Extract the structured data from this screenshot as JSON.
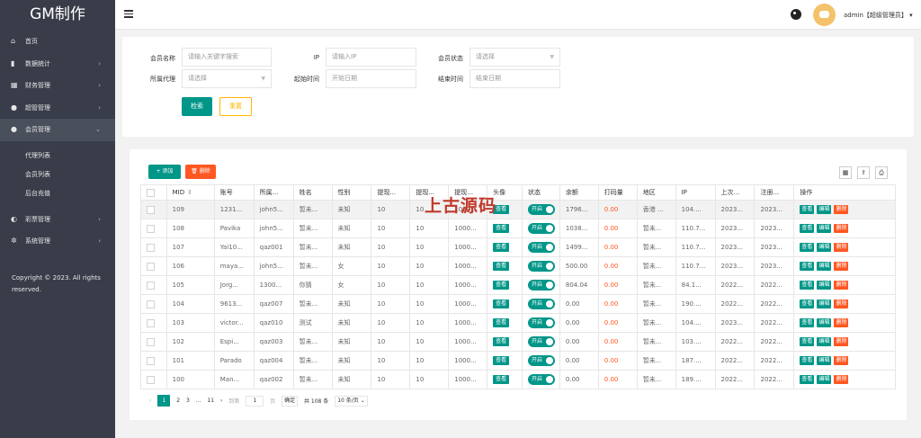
{
  "sidebar": {
    "logo": "GM制作",
    "items": [
      {
        "label": "首页",
        "icon": "home-icon",
        "glyph": "⌂",
        "arrow": ""
      },
      {
        "label": "数据统计",
        "icon": "bar-chart-icon",
        "glyph": "▮",
        "arrow": "›"
      },
      {
        "label": "财务管理",
        "icon": "bank-icon",
        "glyph": "▦",
        "arrow": "›"
      },
      {
        "label": "超管管理",
        "icon": "user-icon",
        "glyph": "●",
        "arrow": "›"
      },
      {
        "label": "会员管理",
        "icon": "users-icon",
        "glyph": "●",
        "arrow": "⌄"
      }
    ],
    "sub_items": [
      "代理列表",
      "会员列表",
      "后台充值"
    ],
    "bottom_items": [
      {
        "label": "彩票管理",
        "icon": "gamepad-icon",
        "glyph": "◐",
        "arrow": "›"
      },
      {
        "label": "系统管理",
        "icon": "gear-icon",
        "glyph": "✲",
        "arrow": "›"
      }
    ],
    "copyright": "Copyright © 2023. All rights reserved."
  },
  "header": {
    "user": "admin【超级管理员】",
    "user_caret": "▾"
  },
  "search": {
    "member_name_label": "会员名称",
    "member_name_placeholder": "请输入关键字搜索",
    "ip_label": "IP",
    "ip_placeholder": "请输入IP",
    "status_label": "会员状态",
    "status_placeholder": "请选择",
    "agent_label": "所属代理",
    "agent_placeholder": "请选择",
    "start_label": "起始时间",
    "start_placeholder": "开始日期",
    "end_label": "结束时间",
    "end_placeholder": "结束日期",
    "search_button": "检索",
    "reset_button": "重置"
  },
  "toolbar": {
    "add_label": "+ 添加",
    "delete_label": "🗑 删除",
    "tools": [
      "▦",
      "⇪",
      "⎙"
    ]
  },
  "table": {
    "columns": [
      "",
      "MID",
      "账号",
      "所属...",
      "姓名",
      "性别",
      "提现...",
      "提现...",
      "提现...",
      "头像",
      "状态",
      "余额",
      "打码量",
      "地区",
      "IP",
      "上次...",
      "注册...",
      "操作"
    ],
    "rows": [
      [
        "109",
        "1231...",
        "john5...",
        "暂未...",
        "未知",
        "10",
        "10",
        "1000...",
        "查看",
        "开启",
        "1796...",
        "0.00",
        "香港 ...",
        "104....",
        "2023...",
        "2023..."
      ],
      [
        "108",
        "Pavika",
        "john5...",
        "暂未...",
        "未知",
        "10",
        "10",
        "1000...",
        "查看",
        "开启",
        "1038...",
        "0.00",
        "暂未...",
        "110.7...",
        "2023...",
        "2023..."
      ],
      [
        "107",
        "Yai10...",
        "qaz001",
        "暂未...",
        "未知",
        "10",
        "10",
        "1000...",
        "查看",
        "开启",
        "1499...",
        "0.00",
        "暂未...",
        "110.7...",
        "2023...",
        "2023..."
      ],
      [
        "106",
        "maya...",
        "john5...",
        "暂未...",
        "女",
        "10",
        "10",
        "1000...",
        "查看",
        "开启",
        "500.00",
        "0.00",
        "暂未...",
        "110.7...",
        "2023...",
        "2023..."
      ],
      [
        "105",
        "Jorg...",
        "1300...",
        "你猜",
        "女",
        "10",
        "10",
        "1000...",
        "查看",
        "开启",
        "804.04",
        "0.00",
        "暂未...",
        "84.1...",
        "2022...",
        "2022..."
      ],
      [
        "104",
        "9613...",
        "qaz007",
        "暂未...",
        "未知",
        "10",
        "10",
        "1000...",
        "查看",
        "开启",
        "0.00",
        "0.00",
        "暂未...",
        "190....",
        "2022...",
        "2022..."
      ],
      [
        "103",
        "victor...",
        "qaz010",
        "测试",
        "未知",
        "10",
        "10",
        "1000...",
        "查看",
        "开启",
        "0.00",
        "0.00",
        "暂未...",
        "104....",
        "2023...",
        "2022..."
      ],
      [
        "102",
        "Espi...",
        "qaz003",
        "暂未...",
        "未知",
        "10",
        "10",
        "1000...",
        "查看",
        "开启",
        "0.00",
        "0.00",
        "暂未...",
        "103....",
        "2022...",
        "2022..."
      ],
      [
        "101",
        "Parado",
        "qaz004",
        "暂未...",
        "未知",
        "10",
        "10",
        "1000...",
        "查看",
        "开启",
        "0.00",
        "0.00",
        "暂未...",
        "187....",
        "2022...",
        "2022..."
      ],
      [
        "100",
        "Man...",
        "qaz002",
        "暂未...",
        "未知",
        "10",
        "10",
        "1000...",
        "查看",
        "开启",
        "0.00",
        "0.00",
        "暂未...",
        "189....",
        "2022...",
        "2022..."
      ]
    ],
    "actions": [
      "查看",
      "编辑",
      "删除"
    ]
  },
  "pager": {
    "prev": "‹",
    "pages": [
      "1",
      "2",
      "3"
    ],
    "ellipsis": "...",
    "last": "11",
    "next": "›",
    "goto_label": "到第",
    "goto_value": "1",
    "page_unit": "页",
    "confirm": "确定",
    "total": "共 108 条",
    "per_page": "10 条/页 ⌄"
  },
  "watermark": "上古源码",
  "colors": {
    "primary": "#009688",
    "danger": "#ff5722",
    "warn": "#ffb800",
    "sidebar": "#393d49"
  }
}
